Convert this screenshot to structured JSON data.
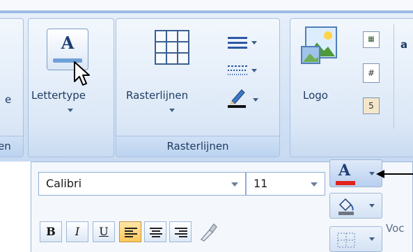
{
  "ribbon": {
    "partial_left_label": "e",
    "partial_left_caption": "en",
    "font_button": {
      "label": "Lettertype",
      "icon": "letter-a-icon",
      "glyph": "A"
    },
    "gridlines_button": {
      "label": "Rasterlijnen",
      "icon": "grid-icon"
    },
    "gridlines_group_caption": "Rasterlijnen",
    "logo_button": {
      "label": "Logo",
      "icon": "picture-icon"
    },
    "cut_text": "a"
  },
  "font_panel": {
    "font_name": "Calibri",
    "font_size": "11",
    "bold_label": "B",
    "italic_label": "I",
    "underline_label": "U",
    "font_color_glyph": "A",
    "partial_caption": "Voc"
  },
  "colors": {
    "ribbon_accent": "#9bbbe3",
    "font_color_bar": "#e0241b",
    "align_active": "#ffc85a"
  }
}
